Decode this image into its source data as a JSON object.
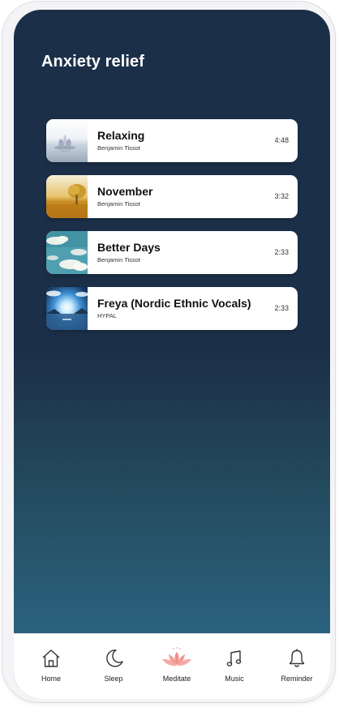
{
  "screen": {
    "title": "Anxiety relief"
  },
  "tracks": [
    {
      "title": "Relaxing",
      "artist": "Benjamin Tissot",
      "duration": "4:48",
      "thumb": "lotus-on-water-image"
    },
    {
      "title": "November",
      "artist": "Benjamin Tissot",
      "duration": "3:32",
      "thumb": "tree-in-golden-field-image"
    },
    {
      "title": "Better Days",
      "artist": "Benjamin Tissot",
      "duration": "2:33",
      "thumb": "clouds-in-sky-image"
    },
    {
      "title": "Freya (Nordic Ethnic Vocals)",
      "artist": "HYPAL",
      "duration": "2:33",
      "thumb": "sun-over-fjord-image"
    }
  ],
  "tabbar": {
    "items": [
      {
        "label": "Home",
        "icon": "home-icon"
      },
      {
        "label": "Sleep",
        "icon": "moon-icon"
      },
      {
        "label": "Meditate",
        "icon": "lotus-icon",
        "active": true
      },
      {
        "label": "Music",
        "icon": "music-note-icon"
      },
      {
        "label": "Reminder",
        "icon": "bell-icon"
      }
    ]
  },
  "colors": {
    "background_top": "#1c2f49",
    "background_bottom": "#2e6d8d",
    "card": "#ffffff",
    "active_icon": "#f08e8a"
  }
}
